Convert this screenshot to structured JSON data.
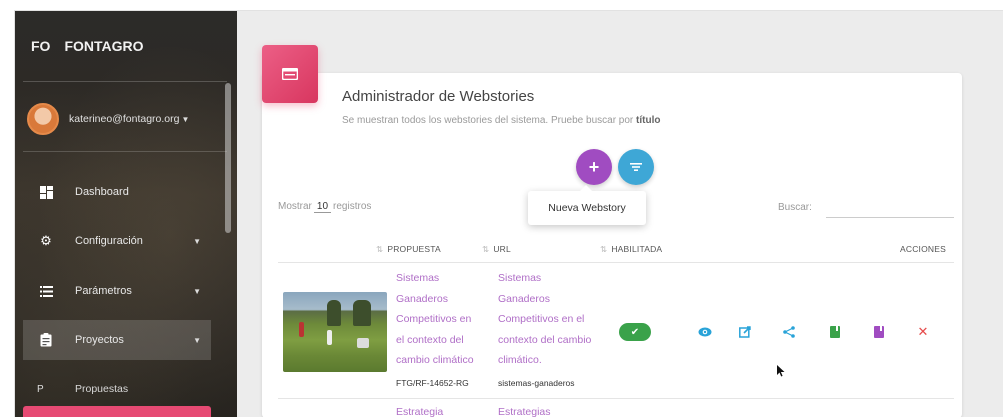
{
  "sidebar": {
    "brand_short": "FO",
    "brand_name": "FONTAGRO",
    "user_email": "katerineo@fontagro.org",
    "items": [
      {
        "label": "Dashboard",
        "icon": "dashboard-icon"
      },
      {
        "label": "Configuración",
        "icon": "gear-icon"
      },
      {
        "label": "Parámetros",
        "icon": "list-icon"
      },
      {
        "label": "Proyectos",
        "icon": "clipboard-icon"
      },
      {
        "label": "Propuestas",
        "letter": "P"
      }
    ]
  },
  "card": {
    "title": "Administrador de Webstories",
    "subtitle": "Se muestran todos los webstories del sistema. Pruebe buscar por",
    "subtitle_bold": "título"
  },
  "fab": {
    "add": "+",
    "tooltip": "Nueva Webstory"
  },
  "table_controls": {
    "show_label": "Mostrar",
    "show_value": "10",
    "records_label": "registros",
    "search_label": "Buscar:"
  },
  "table": {
    "headers": [
      "PROPUESTA",
      "URL",
      "HABILITADA",
      "ACCIONES"
    ],
    "rows": [
      {
        "propuesta": "Sistemas\nGanaderos\nCompetitivos en\nel contexto del\ncambio climático",
        "code": "FTG/RF-14652-RG",
        "url": "Sistemas\nGanaderos\nCompetitivos en el\ncontexto del cambio\nclimático.",
        "slug": "sistemas-ganaderos",
        "enabled": true
      },
      {
        "propuesta": "Estrategia",
        "url": "Estrategias"
      }
    ]
  },
  "colors": {
    "accent_pink": "#e64a73",
    "fab_purple": "#a04cc1",
    "fab_blue": "#3ea7d6",
    "link_purple": "#b06fc7",
    "enabled_green": "#3aa24a",
    "action_blue": "#29a3d8",
    "action_green": "#3aa24a",
    "action_purple": "#a04cc1",
    "action_red": "#e64a4a"
  }
}
